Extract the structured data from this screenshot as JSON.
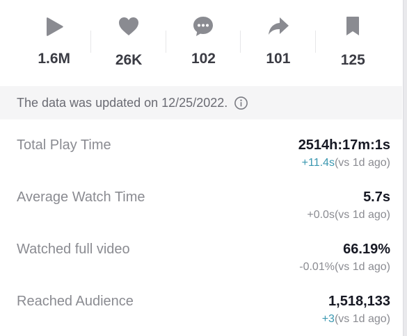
{
  "stats": [
    {
      "icon": "play-icon",
      "value": "1.6M"
    },
    {
      "icon": "heart-icon",
      "value": "26K"
    },
    {
      "icon": "comment-icon",
      "value": "102"
    },
    {
      "icon": "share-icon",
      "value": "101"
    },
    {
      "icon": "bookmark-icon",
      "value": "125"
    }
  ],
  "notice": {
    "text": "The data was updated on 12/25/2022.",
    "icon": "info-icon"
  },
  "metrics": [
    {
      "label": "Total Play Time",
      "value": "2514h:17m:1s",
      "delta": "+11.4s",
      "compare": "(vs 1d ago)",
      "delta_positive": true
    },
    {
      "label": "Average Watch Time",
      "value": "5.7s",
      "delta": "+0.0s",
      "compare": "(vs 1d ago)",
      "delta_positive": false
    },
    {
      "label": "Watched full video",
      "value": "66.19%",
      "delta": "-0.01%",
      "compare": "(vs 1d ago)",
      "delta_positive": false
    },
    {
      "label": "Reached Audience",
      "value": "1,518,133",
      "delta": "+3",
      "compare": "(vs 1d ago)",
      "delta_positive": true
    }
  ],
  "colors": {
    "icon_gray": "#8a8b91",
    "positive_delta": "#3a97b0",
    "notice_bg": "#f5f5f6"
  }
}
